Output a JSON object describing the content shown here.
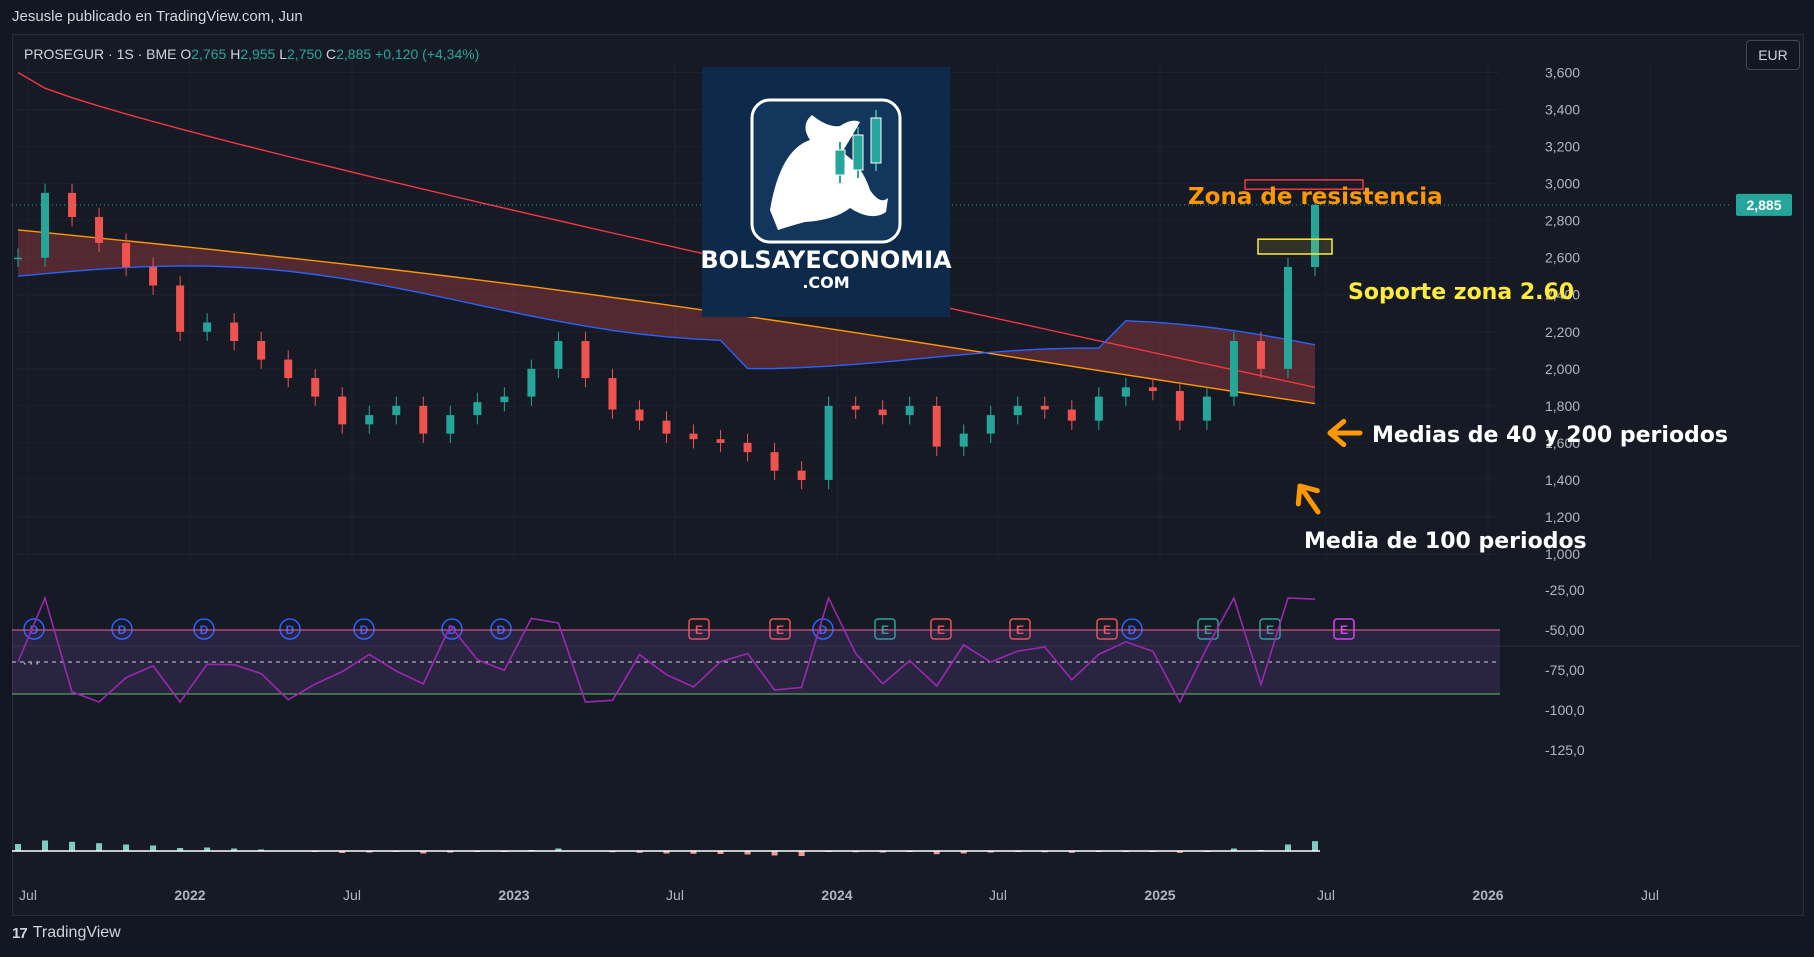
{
  "header": {
    "published_by": "Jesusle publicado en TradingView.com, Jun"
  },
  "legend": {
    "symbol": "PROSEGUR · 1S · BME",
    "open_label": "O",
    "open": "2,765",
    "high_label": "H",
    "high": "2,955",
    "low_label": "L",
    "low": "2,750",
    "close_label": "C",
    "close": "2,885",
    "change": "+0,120 (+4,34%)"
  },
  "currency": "EUR",
  "last_price_tag": "2,885",
  "indicator_menu": "···",
  "footer": {
    "brand": "TradingView",
    "logo_glyph": "17"
  },
  "logo": {
    "line1": "BOLSAYECONOMIA",
    "line2": ".COM",
    "icon": "bull-with-candles-icon"
  },
  "annotations": {
    "resistance": "Zona de resistencia",
    "support": "Soporte zona 2.60",
    "ma_40_200": "Medias de 40 y 200 periodos",
    "ma_100": "Media de 100 periodos"
  },
  "colors": {
    "up": "#26a69a",
    "down": "#ef5350",
    "ma40": "#2962ff",
    "ma100": "#ff9800",
    "ma200": "#f23645",
    "rsi": "#9c27b0",
    "annotation_orange": "#ff9800",
    "annotation_yellow": "#ffeb3b"
  },
  "chart_data": {
    "type": "candlestick",
    "symbol": "PROSEGUR",
    "interval": "1S",
    "exchange": "BME",
    "currency": "EUR",
    "x_ticks": [
      "Jul",
      "2022",
      "Jul",
      "2023",
      "Jul",
      "2024",
      "Jul",
      "2025",
      "Jul",
      "2026",
      "Jul"
    ],
    "price_ticks": [
      "3,600",
      "3,400",
      "3,200",
      "3,000",
      "2,800",
      "2,600",
      "2,400",
      "2,200",
      "2,000",
      "1,800",
      "1,600",
      "1,400",
      "1,200",
      "1,000"
    ],
    "ylim": [
      1.0,
      3.7
    ],
    "last_close": 2.885,
    "close_series": [
      {
        "t": "2021-06",
        "c": 2.6
      },
      {
        "t": "2021-07",
        "c": 2.95
      },
      {
        "t": "2021-08",
        "c": 2.82
      },
      {
        "t": "2021-09",
        "c": 2.68
      },
      {
        "t": "2021-10",
        "c": 2.55
      },
      {
        "t": "2021-11",
        "c": 2.45
      },
      {
        "t": "2021-12",
        "c": 2.2
      },
      {
        "t": "2022-01",
        "c": 2.25
      },
      {
        "t": "2022-02",
        "c": 2.15
      },
      {
        "t": "2022-03",
        "c": 2.05
      },
      {
        "t": "2022-04",
        "c": 1.95
      },
      {
        "t": "2022-05",
        "c": 1.85
      },
      {
        "t": "2022-06",
        "c": 1.7
      },
      {
        "t": "2022-07",
        "c": 1.75
      },
      {
        "t": "2022-08",
        "c": 1.8
      },
      {
        "t": "2022-09",
        "c": 1.65
      },
      {
        "t": "2022-10",
        "c": 1.75
      },
      {
        "t": "2022-11",
        "c": 1.82
      },
      {
        "t": "2022-12",
        "c": 1.85
      },
      {
        "t": "2023-01",
        "c": 2.0
      },
      {
        "t": "2023-02",
        "c": 2.15
      },
      {
        "t": "2023-03",
        "c": 1.95
      },
      {
        "t": "2023-04",
        "c": 1.78
      },
      {
        "t": "2023-05",
        "c": 1.72
      },
      {
        "t": "2023-06",
        "c": 1.65
      },
      {
        "t": "2023-07",
        "c": 1.62
      },
      {
        "t": "2023-08",
        "c": 1.6
      },
      {
        "t": "2023-09",
        "c": 1.55
      },
      {
        "t": "2023-10",
        "c": 1.45
      },
      {
        "t": "2023-11",
        "c": 1.4
      },
      {
        "t": "2023-12",
        "c": 1.8
      },
      {
        "t": "2024-01",
        "c": 1.78
      },
      {
        "t": "2024-02",
        "c": 1.75
      },
      {
        "t": "2024-03",
        "c": 1.8
      },
      {
        "t": "2024-04",
        "c": 1.58
      },
      {
        "t": "2024-05",
        "c": 1.65
      },
      {
        "t": "2024-06",
        "c": 1.75
      },
      {
        "t": "2024-07",
        "c": 1.8
      },
      {
        "t": "2024-08",
        "c": 1.78
      },
      {
        "t": "2024-09",
        "c": 1.72
      },
      {
        "t": "2024-10",
        "c": 1.85
      },
      {
        "t": "2024-11",
        "c": 1.9
      },
      {
        "t": "2024-12",
        "c": 1.88
      },
      {
        "t": "2025-01",
        "c": 1.72
      },
      {
        "t": "2025-02",
        "c": 1.85
      },
      {
        "t": "2025-03",
        "c": 2.15
      },
      {
        "t": "2025-04",
        "c": 2.0
      },
      {
        "t": "2025-05",
        "c": 2.55
      },
      {
        "t": "2025-06",
        "c": 2.885
      }
    ],
    "moving_averages": [
      {
        "name": "MA 40",
        "color": "#2962ff",
        "start": 2.5,
        "end": 2.08
      },
      {
        "name": "MA 100",
        "color": "#ff9800",
        "start": 2.75,
        "end": 1.85
      },
      {
        "name": "MA 200",
        "color": "#f23645",
        "start": 3.6,
        "end": 1.9
      }
    ],
    "event_markers": [
      {
        "type": "D"
      },
      {
        "type": "D"
      },
      {
        "type": "D"
      },
      {
        "type": "D"
      },
      {
        "type": "D"
      },
      {
        "type": "D"
      },
      {
        "type": "D"
      },
      {
        "type": "E"
      },
      {
        "type": "E"
      },
      {
        "type": "D"
      },
      {
        "type": "E"
      },
      {
        "type": "E"
      },
      {
        "type": "E"
      },
      {
        "type": "E"
      },
      {
        "type": "D"
      },
      {
        "type": "E"
      },
      {
        "type": "E"
      },
      {
        "type": "E"
      }
    ],
    "oscillator_ticks": [
      "-25,00",
      "-50,00",
      "-75,00",
      "-100,0",
      "-125,0"
    ],
    "oscillator_band": [
      -50,
      -90
    ],
    "oscillator_mid": -70,
    "resistance_zone": [
      2.97,
      3.02
    ],
    "support_zone": [
      2.62,
      2.7
    ]
  }
}
